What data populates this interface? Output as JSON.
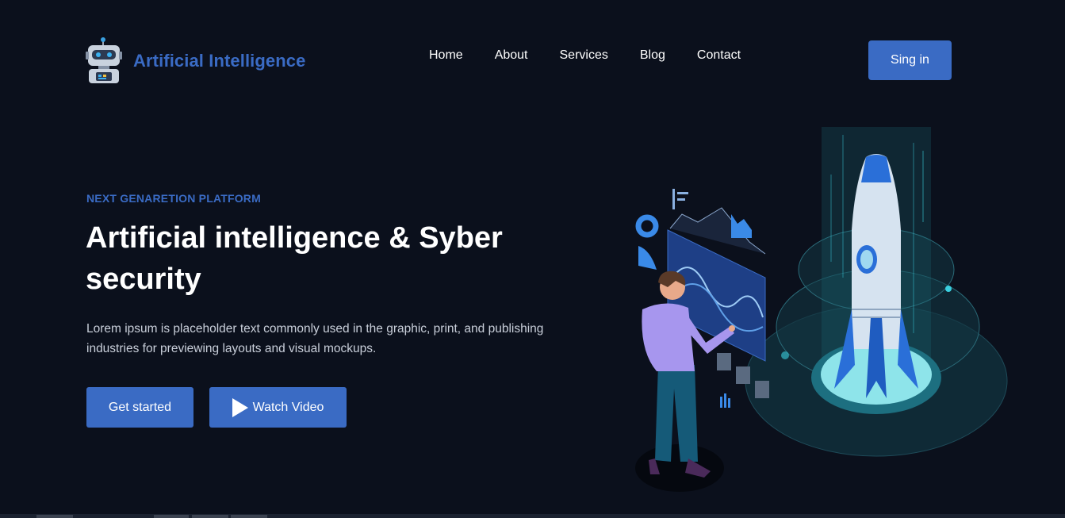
{
  "header": {
    "brand": "Artificial Intelligence",
    "nav": [
      "Home",
      "About",
      "Services",
      "Blog",
      "Contact"
    ],
    "signin_label": "Sing in"
  },
  "hero": {
    "eyebrow": "NEXT GENARETION PLATFORM",
    "title": "Artificial intelligence & Syber security",
    "description": "Lorem ipsum is placeholder text commonly used in the graphic, print, and publishing industries for previewing layouts and visual mockups.",
    "primary_button": "Get started",
    "secondary_button": "Watch Video"
  },
  "icons": {
    "logo": "robot-icon",
    "play": "play-icon"
  },
  "colors": {
    "background": "#0b101c",
    "accent": "#3a6bc4",
    "text": "#ffffff",
    "muted_text": "#c9cfda",
    "rocket_glow": "#8ee4ea"
  }
}
